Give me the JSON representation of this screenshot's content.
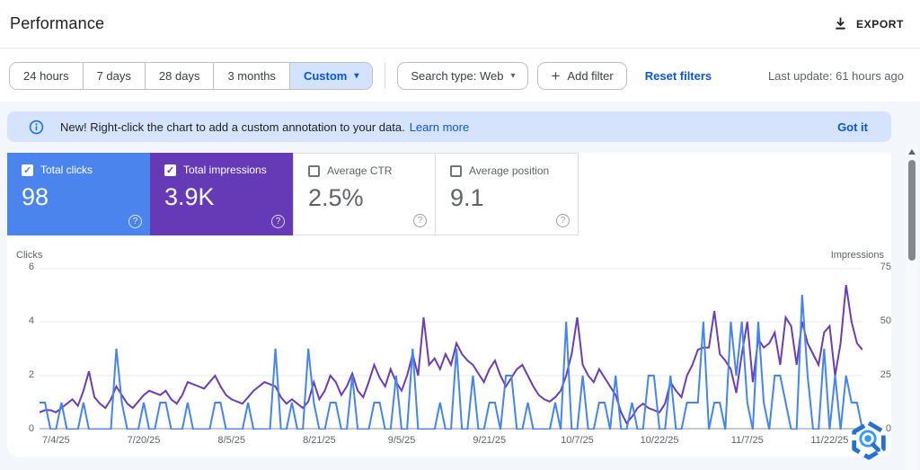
{
  "header": {
    "title": "Performance",
    "export_label": "EXPORT"
  },
  "toolbar": {
    "date_ranges": [
      "24 hours",
      "7 days",
      "28 days",
      "3 months"
    ],
    "custom_label": "Custom",
    "search_type_label": "Search type: Web",
    "add_filter_label": "Add filter",
    "reset_filters_label": "Reset filters",
    "last_update": "Last update: 61 hours ago"
  },
  "banner": {
    "message": "New! Right-click the chart to add a custom annotation to your data.",
    "learn_more": "Learn more",
    "dismiss": "Got it"
  },
  "metrics": {
    "cards": [
      {
        "label": "Total clicks",
        "value": "98",
        "checked": true,
        "color": "#4b84ed"
      },
      {
        "label": "Total impressions",
        "value": "3.9K",
        "checked": true,
        "color": "#6639b7"
      },
      {
        "label": "Average CTR",
        "value": "2.5%",
        "checked": false
      },
      {
        "label": "Average position",
        "value": "9.1",
        "checked": false
      }
    ]
  },
  "glyphs": {
    "caret": "▾",
    "plus": "+",
    "help": "?",
    "check": "✓"
  },
  "chart_data": {
    "type": "line",
    "title": "",
    "grid": true,
    "days_total": 151,
    "date_span": "7/1/25 - 11/28/25",
    "left_axis": {
      "title": "Clicks",
      "ticks": [
        6,
        4,
        2,
        0
      ],
      "range": [
        0,
        6
      ]
    },
    "right_axis": {
      "title": "Impressions",
      "ticks": [
        75,
        50,
        25,
        0
      ],
      "range": [
        0,
        75
      ]
    },
    "x_ticks": [
      {
        "label": "7/4/25",
        "day": 3
      },
      {
        "label": "7/20/25",
        "day": 19
      },
      {
        "label": "8/5/25",
        "day": 35
      },
      {
        "label": "8/21/25",
        "day": 51
      },
      {
        "label": "9/5/25",
        "day": 66
      },
      {
        "label": "9/21/25",
        "day": 82
      },
      {
        "label": "10/7/25",
        "day": 98
      },
      {
        "label": "10/22/25",
        "day": 113
      },
      {
        "label": "11/7/25",
        "day": 129
      },
      {
        "label": "11/22/25",
        "day": 144
      }
    ],
    "series": [
      {
        "name": "Clicks",
        "axis": "left",
        "color": "#4285f4",
        "values": [
          1,
          1,
          0,
          0,
          1,
          0,
          0,
          0,
          1,
          0,
          0,
          0,
          0,
          0,
          3,
          1,
          0,
          0,
          0,
          1,
          0,
          0,
          1,
          1,
          0,
          0,
          0,
          1,
          0,
          0,
          0,
          0,
          1,
          1,
          0,
          0,
          0,
          0,
          1,
          0,
          0,
          0,
          0,
          3,
          0,
          0,
          1,
          0,
          0,
          3,
          1,
          0,
          0,
          1,
          1,
          0,
          0,
          2,
          0,
          0,
          0,
          1,
          1,
          0,
          0,
          2,
          0,
          0,
          3,
          0,
          0,
          0,
          0,
          1,
          0,
          0,
          3,
          0,
          0,
          2,
          0,
          0,
          1,
          1,
          0,
          2,
          2,
          0,
          0,
          1,
          0,
          0,
          0,
          0,
          1,
          0,
          4,
          0,
          0,
          2,
          0,
          0,
          1,
          1,
          0,
          2,
          0,
          0,
          1,
          0,
          0,
          2,
          2,
          0,
          0,
          2,
          0,
          0,
          1,
          1,
          1,
          4,
          0,
          1,
          1,
          0,
          4,
          2,
          4,
          1,
          0,
          4,
          1,
          0,
          2,
          2,
          1,
          0,
          0,
          5,
          2,
          0,
          0,
          3,
          0,
          2,
          0,
          2,
          1,
          1,
          0
        ]
      },
      {
        "name": "Impressions",
        "axis": "right",
        "color": "#6c3db8",
        "values": [
          8,
          9,
          9,
          8,
          10,
          12,
          14,
          11,
          18,
          27,
          15,
          12,
          10,
          14,
          20,
          16,
          12,
          10,
          13,
          16,
          18,
          17,
          16,
          18,
          14,
          12,
          16,
          22,
          21,
          20,
          19,
          22,
          25,
          20,
          16,
          14,
          13,
          12,
          15,
          18,
          20,
          22,
          21,
          20,
          15,
          12,
          14,
          12,
          10,
          13,
          22,
          14,
          18,
          25,
          22,
          16,
          20,
          26,
          18,
          15,
          22,
          30,
          24,
          20,
          28,
          22,
          18,
          25,
          35,
          25,
          52,
          30,
          33,
          28,
          35,
          30,
          40,
          35,
          32,
          30,
          26,
          22,
          28,
          32,
          25,
          20,
          24,
          28,
          30,
          25,
          20,
          16,
          14,
          13,
          15,
          18,
          25,
          35,
          52,
          30,
          25,
          22,
          28,
          24,
          20,
          16,
          8,
          3,
          6,
          10,
          12,
          10,
          9,
          8,
          12,
          22,
          18,
          15,
          25,
          30,
          37,
          38,
          38,
          55,
          35,
          32,
          28,
          17,
          35,
          50,
          22,
          42,
          38,
          40,
          45,
          30,
          52,
          48,
          30,
          50,
          40,
          35,
          30,
          45,
          48,
          25,
          40,
          67,
          50,
          40,
          37
        ]
      }
    ]
  }
}
